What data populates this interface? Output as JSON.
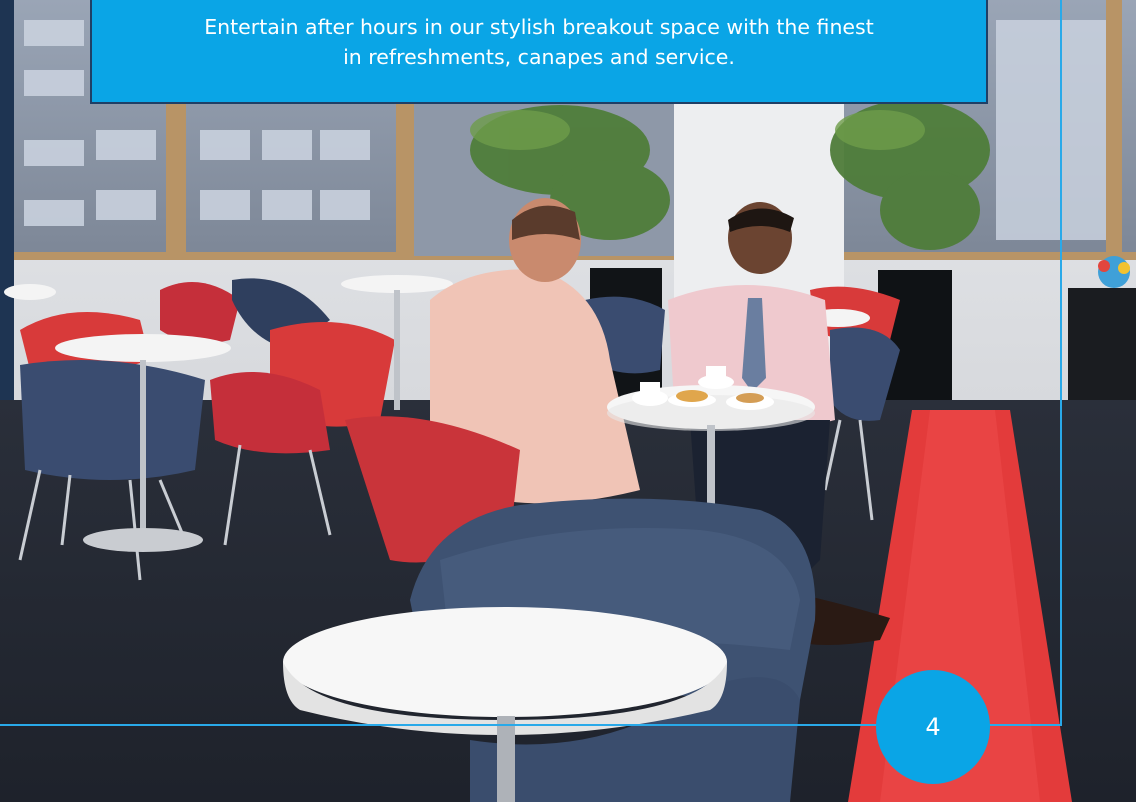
{
  "caption": {
    "line1": "Entertain after hours in our stylish breakout space with the finest",
    "line2": "in refreshments, canapes and service."
  },
  "page_number": "4",
  "colors": {
    "accent": "#0aa5e6",
    "frame_line": "#29a9e9",
    "caption_border": "#1f3f66"
  }
}
